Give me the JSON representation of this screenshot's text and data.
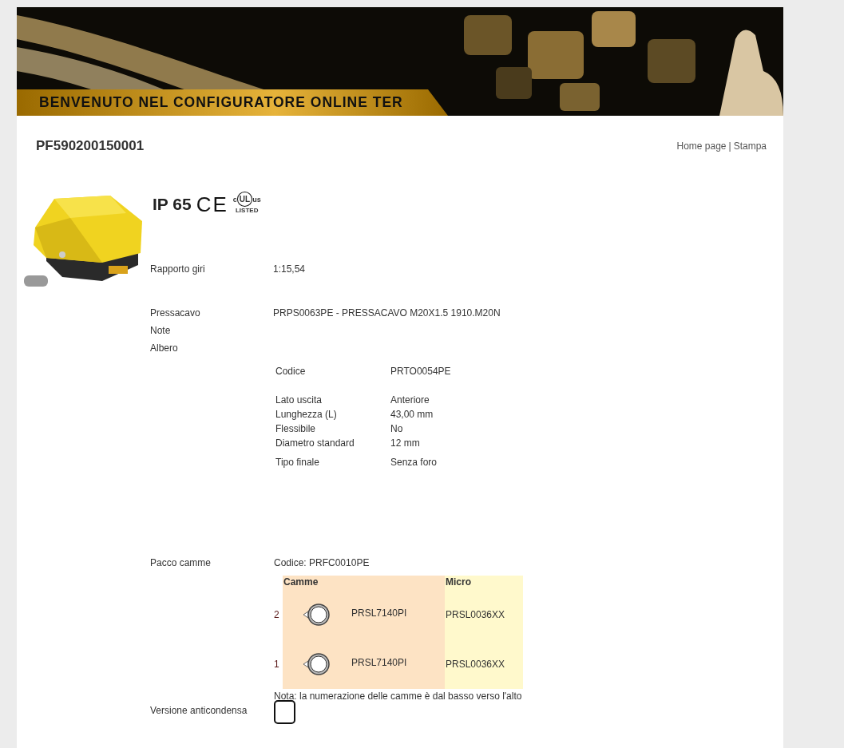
{
  "banner": {
    "title": "BENVENUTO NEL CONFIGURATORE ONLINE TER"
  },
  "header": {
    "code": "PF590200150001",
    "links": [
      "Home page",
      "Stampa"
    ],
    "separator": "|"
  },
  "product": {
    "certifications": {
      "ip": "IP 65",
      "ce": "CE",
      "ul": {
        "left": "c",
        "center": "UL",
        "right": "us",
        "bottom": "LISTED"
      }
    }
  },
  "specs": [
    {
      "label": "Rapporto giri",
      "value": "1:15,54"
    }
  ],
  "specs2": [
    {
      "label": "Pressacavo",
      "value": "PRPS0063PE - PRESSACAVO M20X1.5 1910.M20N"
    },
    {
      "label": "Note"
    },
    {
      "label": "Albero"
    }
  ],
  "shaft": {
    "code_label": "Codice",
    "code": "PRTO0054PE",
    "rows": [
      {
        "label": "Lato uscita",
        "value": "Anteriore"
      },
      {
        "label": "Lunghezza (L)",
        "value": "43,00 mm"
      },
      {
        "label": "Flessibile",
        "value": "No"
      },
      {
        "label": "Diametro standard",
        "value": "12 mm"
      }
    ],
    "end": {
      "label": "Tipo finale",
      "value": "Senza foro"
    }
  },
  "cams": {
    "label": "Pacco camme",
    "code": "Codice: PRFC0010PE",
    "columns": [
      "Camme",
      "Micro"
    ],
    "rows": [
      {
        "number": "2",
        "cam": "PRSL7140PI",
        "micro": "PRSL0036XX"
      },
      {
        "number": "1",
        "cam": "PRSL7140PI",
        "micro": "PRSL0036XX"
      }
    ],
    "note": "Nota: la numerazione delle camme è dal basso verso l'alto"
  },
  "anticondensa": {
    "label": "Versione anticondensa",
    "checked": false
  }
}
